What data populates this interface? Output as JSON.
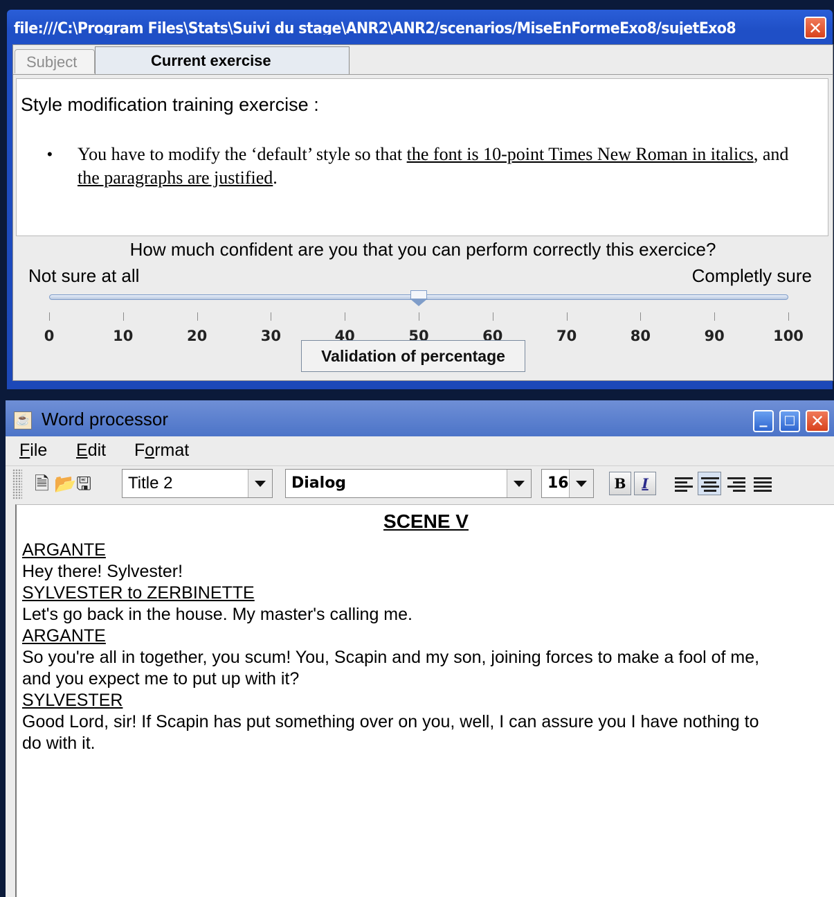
{
  "exercise_window": {
    "title": "file:///C:\\Program Files\\Stats\\Suivi du stage\\ANR2\\ANR2/scenarios/MiseEnFormeExo8/sujetExo8_...",
    "tabs": [
      {
        "label": "Subject",
        "selected": false
      },
      {
        "label": "Current exercise",
        "selected": true
      }
    ],
    "heading": "Style modification training exercise :",
    "instruction": {
      "bullet": "•",
      "part1": "You have to modify the ‘default’ style so that ",
      "underline1": "the font is 10-point Times New Roman in italics",
      "part2": ", and ",
      "underline2": "the paragraphs are justified",
      "part3": "."
    },
    "confidence": {
      "question": "How much confident are you that you can perform correctly this exercice?",
      "low_label": "Not sure at all",
      "high_label": "Completly sure",
      "min": 0,
      "max": 100,
      "value": 50,
      "ticks": [
        "0",
        "10",
        "20",
        "30",
        "40",
        "50",
        "60",
        "70",
        "80",
        "90",
        "100"
      ]
    },
    "validate_label": "Validation of percentage"
  },
  "word_processor": {
    "title": "Word processor",
    "menus": [
      "File",
      "Edit",
      "Format"
    ],
    "toolbar": {
      "style": "Title 2",
      "font": "Dialog",
      "size": "16",
      "bold_label": "B",
      "italic_label": "I",
      "active_alignment": "center"
    },
    "document": {
      "scene_title": "SCENE V",
      "lines": [
        {
          "text": "ARGANTE",
          "speaker": true
        },
        {
          "text": "Hey there! Sylvester!",
          "speaker": false
        },
        {
          "text": "SYLVESTER to ZERBINETTE",
          "speaker": true
        },
        {
          "text": "Let's go back in the house. My master's calling me.",
          "speaker": false
        },
        {
          "text": "ARGANTE",
          "speaker": true
        },
        {
          "text": "So you're all in together, you scum! You, Scapin and my son, joining forces to make a fool of me, and you expect me to put up with it?",
          "speaker": false
        },
        {
          "text": "SYLVESTER",
          "speaker": true
        },
        {
          "text": "Good Lord, sir! If Scapin has put something over on you, well, I can assure you I have nothing to do with it.",
          "speaker": false
        }
      ]
    }
  },
  "colors": {
    "titlebar_blue": "#1f4fc6",
    "close_red": "#d8421c",
    "panel_gray": "#ececec"
  }
}
